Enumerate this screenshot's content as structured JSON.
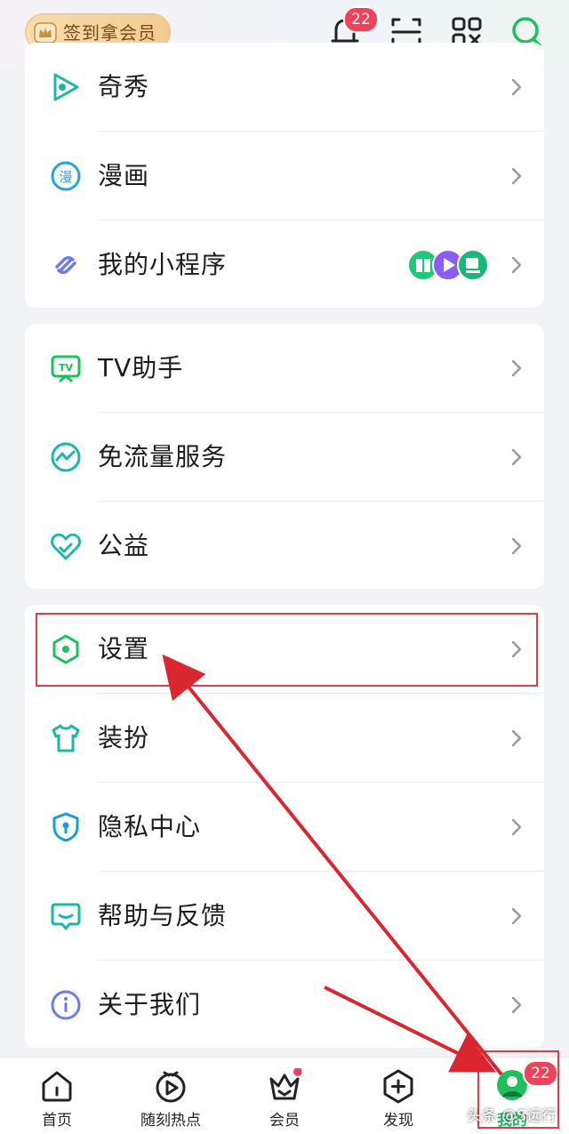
{
  "header": {
    "vip_label": "签到拿会员",
    "notification_count": "22"
  },
  "cards": [
    {
      "items": [
        {
          "label": "奇秀",
          "icon": "qixiu-icon"
        },
        {
          "label": "漫画",
          "icon": "comic-icon"
        },
        {
          "label": "我的小程序",
          "icon": "mini-program-icon"
        }
      ]
    },
    {
      "items": [
        {
          "label": "TV助手",
          "icon": "tv-icon"
        },
        {
          "label": "免流量服务",
          "icon": "traffic-free-icon"
        },
        {
          "label": "公益",
          "icon": "charity-icon"
        }
      ]
    },
    {
      "items": [
        {
          "label": "设置",
          "icon": "settings-icon"
        },
        {
          "label": "装扮",
          "icon": "dressup-icon"
        },
        {
          "label": "隐私中心",
          "icon": "privacy-icon"
        },
        {
          "label": "帮助与反馈",
          "icon": "help-icon"
        },
        {
          "label": "关于我们",
          "icon": "about-icon"
        }
      ]
    }
  ],
  "bottom_nav": {
    "items": [
      {
        "label": "首页",
        "icon": "home-icon"
      },
      {
        "label": "随刻热点",
        "icon": "hot-play-icon"
      },
      {
        "label": "会员",
        "icon": "vip-crown-icon"
      },
      {
        "label": "发现",
        "icon": "discover-icon"
      },
      {
        "label": "我的",
        "icon": "profile-icon"
      }
    ],
    "profile_badge": "22"
  },
  "watermark": "头条 @S远行",
  "colors": {
    "accent_green": "#1fbf5c",
    "teal_icon": "#1bb8a8",
    "badge_red": "#f0425a",
    "annotation_red": "#d9404a"
  }
}
